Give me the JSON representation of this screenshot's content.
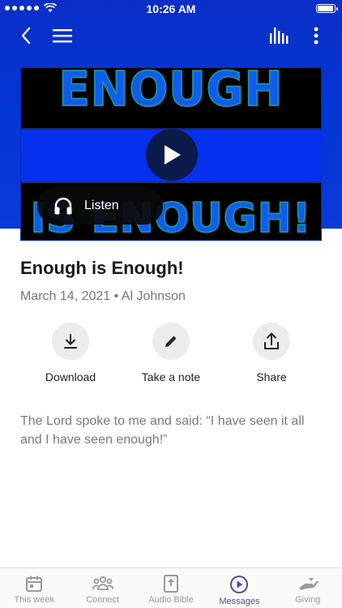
{
  "status_bar": {
    "time": "10:26 AM",
    "battery_level": 1.0
  },
  "video": {
    "top_text": "ENOUGH",
    "bottom_text": "IS ENOUGH!",
    "listen_label": "Listen"
  },
  "sermon": {
    "title": "Enough is Enough!",
    "meta": "March 14, 2021 • Al Johnson",
    "description": "The Lord spoke to me and said: “I have seen it all and I have seen enough!”"
  },
  "actions": {
    "download": "Download",
    "note": "Take a note",
    "share": "Share"
  },
  "tabs": [
    {
      "label": "This week",
      "icon": "calendar-icon"
    },
    {
      "label": "Connect",
      "icon": "people-icon"
    },
    {
      "label": "Audio Bible",
      "icon": "bible-icon"
    },
    {
      "label": "Messages",
      "icon": "play-circle-icon",
      "active": true
    },
    {
      "label": "Giving",
      "icon": "giving-hand-icon"
    }
  ],
  "colors": {
    "header_blue": "#0336d6",
    "active_tab": "#4b4fa0"
  }
}
